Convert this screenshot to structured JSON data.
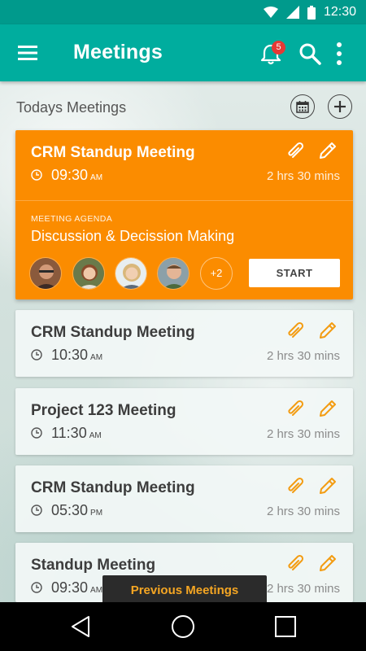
{
  "status_bar": {
    "time": "12:30"
  },
  "app_bar": {
    "title": "Meetings",
    "notification_count": "5"
  },
  "section": {
    "title": "Todays Meetings"
  },
  "featured_meeting": {
    "name": "CRM Standup Meeting",
    "time": "09:30",
    "ampm": "AM",
    "duration": "2 hrs  30 mins",
    "agenda_label": "MEETING AGENDA",
    "agenda": "Discussion & Decission Making",
    "extra_attendees": "+2",
    "start_label": "START"
  },
  "meetings": [
    {
      "name": "CRM Standup Meeting",
      "time": "10:30",
      "ampm": "AM",
      "duration": "2 hrs  30 mins"
    },
    {
      "name": "Project 123 Meeting",
      "time": "11:30",
      "ampm": "AM",
      "duration": "2 hrs  30 mins"
    },
    {
      "name": "CRM Standup Meeting",
      "time": "05:30",
      "ampm": "PM",
      "duration": "2 hrs  30 mins"
    },
    {
      "name": "Standup Meeting",
      "time": "09:30",
      "ampm": "AM",
      "duration": "2 hrs  30 mins"
    }
  ],
  "previous_meetings_label": "Previous Meetings",
  "colors": {
    "primary": "#00ad9e",
    "status_bar": "#009a8c",
    "accent": "#fb8c00",
    "badge": "#e53935",
    "icon_orange": "#f39c12"
  },
  "icons": {
    "menu": "menu-icon",
    "bell": "bell-icon",
    "search": "search-icon",
    "more": "more-vert-icon",
    "calendar": "calendar-icon",
    "add": "add-icon",
    "clip": "paperclip-icon",
    "edit": "pencil-icon",
    "clock": "clock-icon",
    "back": "back-icon",
    "home": "home-icon",
    "recents": "recents-icon"
  }
}
